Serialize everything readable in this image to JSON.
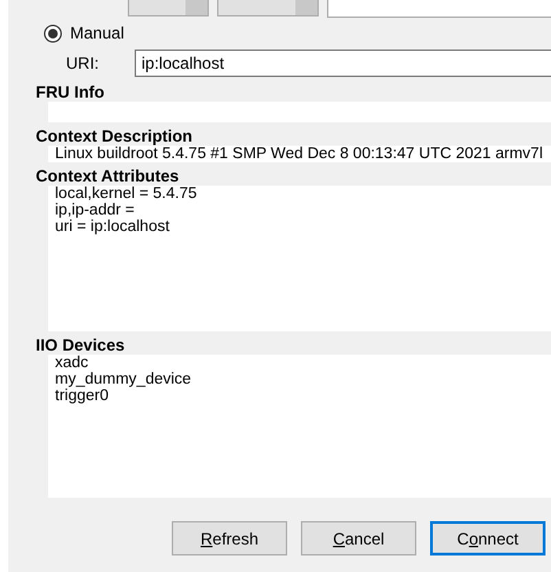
{
  "connection_mode": {
    "label": "Manual",
    "selected": true
  },
  "uri": {
    "label": "URI:",
    "value": "ip:localhost"
  },
  "sections": [
    {
      "title": "FRU Info"
    },
    {
      "title": "Context Description",
      "lines": [
        "Linux buildroot 5.4.75 #1 SMP Wed Dec 8 00:13:47 UTC 2021 armv7l"
      ]
    },
    {
      "title": "Context Attributes",
      "lines": [
        "local,kernel = 5.4.75",
        "ip,ip-addr =",
        "uri = ip:localhost"
      ]
    },
    {
      "title": "IIO Devices",
      "lines": [
        "xadc",
        "my_dummy_device",
        "trigger0"
      ]
    }
  ],
  "buttons": [
    {
      "label": "Refresh",
      "default": false
    },
    {
      "label": "Cancel",
      "default": false
    },
    {
      "label": "Connect",
      "default": true
    }
  ]
}
